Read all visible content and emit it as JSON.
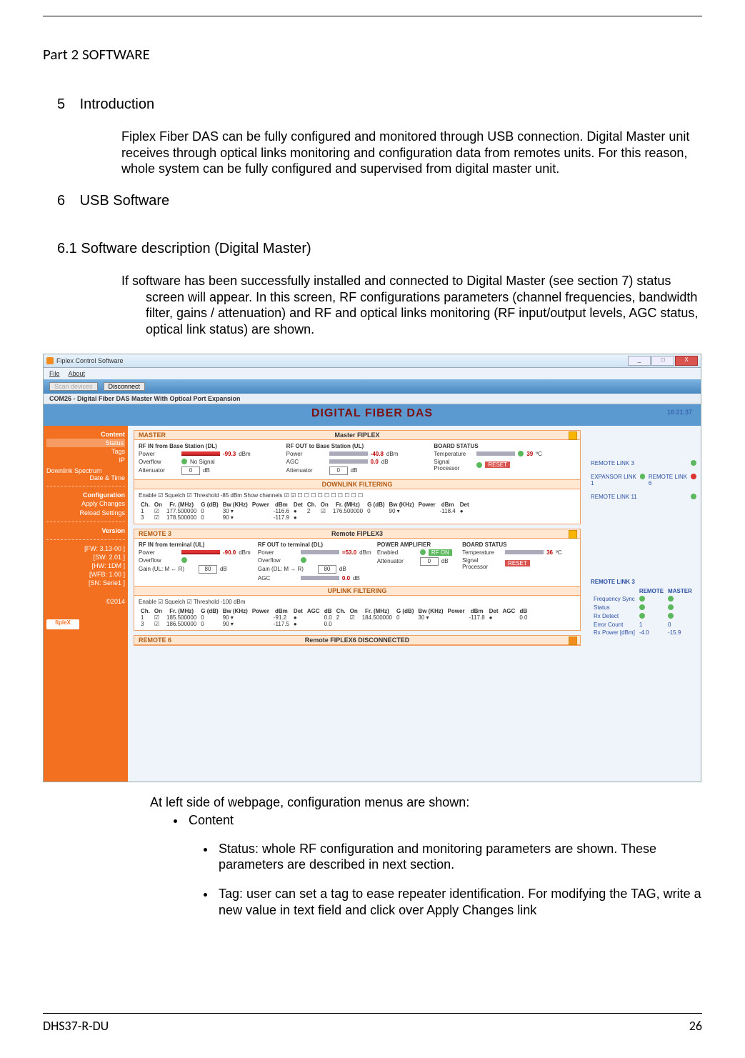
{
  "doc": {
    "part_title": "Part 2 SOFTWARE",
    "sec5_num": "5",
    "sec5_title": "Introduction",
    "sec5_body": "Fiplex Fiber DAS can be fully configured and monitored through USB connection. Digital Master unit receives through optical links monitoring and configuration data from remotes units. For this reason, whole system can be fully configured and supervised from digital master unit.",
    "sec6_num": "6",
    "sec6_title": "USB Software",
    "sec6_1_title": "6.1  Software description (Digital Master)",
    "sec6_1_body": "If software has been successfully installed and connected to Digital Master (see section 7) status screen will appear. In this screen, RF configurations parameters (channel frequencies, bandwidth filter, gains / attenuation) and RF and optical links monitoring (RF input/output levels, AGC status, optical link status) are shown.",
    "after_img_intro": "At left side of webpage, configuration menus are shown:",
    "bullets": {
      "content": "Content",
      "status": "Status: whole RF configuration and monitoring parameters are shown. These parameters are described in next section.",
      "tag": "Tag: user can set a tag to ease repeater identification. For modifying the TAG, write a new value in text field and click over Apply Changes link"
    },
    "footer_left": "DHS37-R-DU",
    "footer_right": "26"
  },
  "app": {
    "window_title": "Fiplex Control Software",
    "menu": {
      "file": "File",
      "about": "About"
    },
    "buttons": {
      "scan": "Scan devices",
      "disconnect": "Disconnect"
    },
    "comline": "COM26 - Digital Fiber DAS Master With Optical Port Expansion",
    "big_title": "DIGITAL FIBER DAS",
    "time": "16:21:37",
    "sidebar": {
      "content": "Content",
      "status": "Status",
      "tags": "Tags",
      "ip": "IP",
      "spectrum": "Downlink Spectrum",
      "datetime": "Date & Time",
      "configuration": "Configuration",
      "apply": "Apply Changes",
      "reload": "Reload Settings",
      "version": "Version",
      "fw": "[FW: 3.13-00 ]",
      "sw": "[SW: 2.01 ]",
      "hw": "[HW:  1DM ]",
      "wfb": "[WFB: 1.00 ]",
      "sn": "[SN: Serie1 ]",
      "copyright": "©2014",
      "logo": "fipleX"
    },
    "master": {
      "header": "MASTER",
      "name": "Master FIPLEX",
      "rfin": {
        "title": "RF IN from Base Station (DL)",
        "power_lbl": "Power",
        "power_val": "-99.3",
        "power_unit": "dBm",
        "overflow_lbl": "Overflow",
        "overflow_val": "No Signal",
        "att_lbl": "Attenuator",
        "att_val": "0",
        "att_unit": "dB"
      },
      "rfout": {
        "title": "RF OUT to Base Station (UL)",
        "power_lbl": "Power",
        "power_val": "-40.8",
        "power_unit": "dBm",
        "agc_lbl": "AGC",
        "agc_val": "0.0",
        "agc_unit": "dB",
        "att_lbl": "Attenuator",
        "att_val": "0",
        "att_unit": "dB"
      },
      "board": {
        "title": "BOARD STATUS",
        "temp_lbl": "Temperature",
        "temp_val": "39",
        "temp_unit": "ºC",
        "sp_lbl": "Signal Processor",
        "reset": "RESET"
      },
      "filtering_title": "DOWNLINK FILTERING",
      "filter_row": "Enable ☑  Squelch ☑  Threshold  -85  dBm   Show channels ☑ ☑ ☐ ☐ ☐ ☐ ☐ ☐ ☐ ☐ ☐ ☐",
      "table": {
        "hdr": [
          "Ch.",
          "On",
          "Fr. (MHz)",
          "G (dB)",
          "Bw (KHz)",
          "Power",
          "dBm",
          "Det",
          "Ch.",
          "On",
          "Fr. (MHz)",
          "G (dB)",
          "Bw (KHz)",
          "Power",
          "dBm",
          "Det"
        ],
        "r1": [
          "1",
          "☑",
          "177.500000",
          "0",
          "30 ▾",
          "",
          "-116.6",
          "●",
          "2",
          "☑",
          "176.500000",
          "0",
          "90 ▾",
          "",
          "-118.4",
          "●"
        ],
        "r2": [
          "3",
          "☑",
          "178.500000",
          "0",
          "90 ▾",
          "",
          "-117.9",
          "●",
          "",
          "",
          "",
          "",
          "",
          "",
          "",
          ""
        ]
      }
    },
    "rightlinks": {
      "exp1": "EXPANSOR LINK 1",
      "r3": "REMOTE LINK 3",
      "r6": "REMOTE LINK 6",
      "r11": "REMOTE LINK 11"
    },
    "remote3": {
      "header": "REMOTE 3",
      "name": "Remote FIPLEX3",
      "rfin": {
        "title": "RF IN from terminal (UL)",
        "power_lbl": "Power",
        "power_val": "-90.0",
        "power_unit": "dBm",
        "ovf": "Overflow",
        "gain_lbl": "Gain (UL: M ← R)",
        "gain_val": "80",
        "gain_unit": "dB"
      },
      "rfout": {
        "title": "RF OUT to terminal (DL)",
        "power_lbl": "Power",
        "power_val": "=53.0",
        "power_unit": "dBm",
        "ovf": "Overflow",
        "gain_lbl": "Gain (DL: M → R)",
        "gain_val": "80",
        "gain_unit": "dB",
        "agc_lbl": "AGC",
        "agc_val": "0.0",
        "agc_unit": "dB"
      },
      "pa": {
        "title": "POWER AMPLIFIER",
        "en_lbl": "Enabled",
        "rfon": "RF ON",
        "att_lbl": "Attenuator",
        "att_val": "0",
        "att_unit": "dB"
      },
      "board": {
        "title": "BOARD STATUS",
        "temp_lbl": "Temperature",
        "temp_val": "36",
        "temp_unit": "ºC",
        "sp_lbl": "Signal Processor",
        "reset": "RESET"
      },
      "filtering_title": "UPLINK FILTERING",
      "filter_row": "Enable ☑  Squelch ☑  Threshold  -100  dBm",
      "table": {
        "hdr": [
          "Ch.",
          "On",
          "Fr. (MHz)",
          "G (dB)",
          "Bw (KHz)",
          "Power",
          "dBm",
          "Det",
          "AGC",
          "dB",
          "Ch.",
          "On",
          "Fr. (MHz)",
          "G (dB)",
          "Bw (KHz)",
          "Power",
          "dBm",
          "Det",
          "AGC",
          "dB"
        ],
        "r1": [
          "1",
          "☑",
          "185.500000",
          "0",
          "90 ▾",
          "",
          "-91.2",
          "●",
          "",
          "0.0",
          "2",
          "☑",
          "184.500000",
          "0",
          "30 ▾",
          "",
          "-117.8",
          "●",
          "",
          "0.0"
        ],
        "r2": [
          "3",
          "☑",
          "186.500000",
          "0",
          "90 ▾",
          "",
          "-117.5",
          "●",
          "",
          "0.0",
          "",
          "",
          "",
          "",
          "",
          "",
          "",
          "",
          "",
          ""
        ]
      },
      "rstats": {
        "title": "REMOTE LINK 3",
        "hdr_remote": "REMOTE",
        "hdr_master": "MASTER",
        "rows": [
          [
            "Frequency Sync",
            "●",
            "●"
          ],
          [
            "Status",
            "●",
            "●"
          ],
          [
            "Rx Detect",
            "●",
            "●"
          ],
          [
            "Error Count",
            "1",
            "0"
          ],
          [
            "Rx Power [dBm]",
            "-4.0",
            "-15.9"
          ]
        ]
      }
    },
    "remote6": {
      "header": "REMOTE 6",
      "name": "Remote FIPLEX6   DISCONNECTED"
    }
  }
}
